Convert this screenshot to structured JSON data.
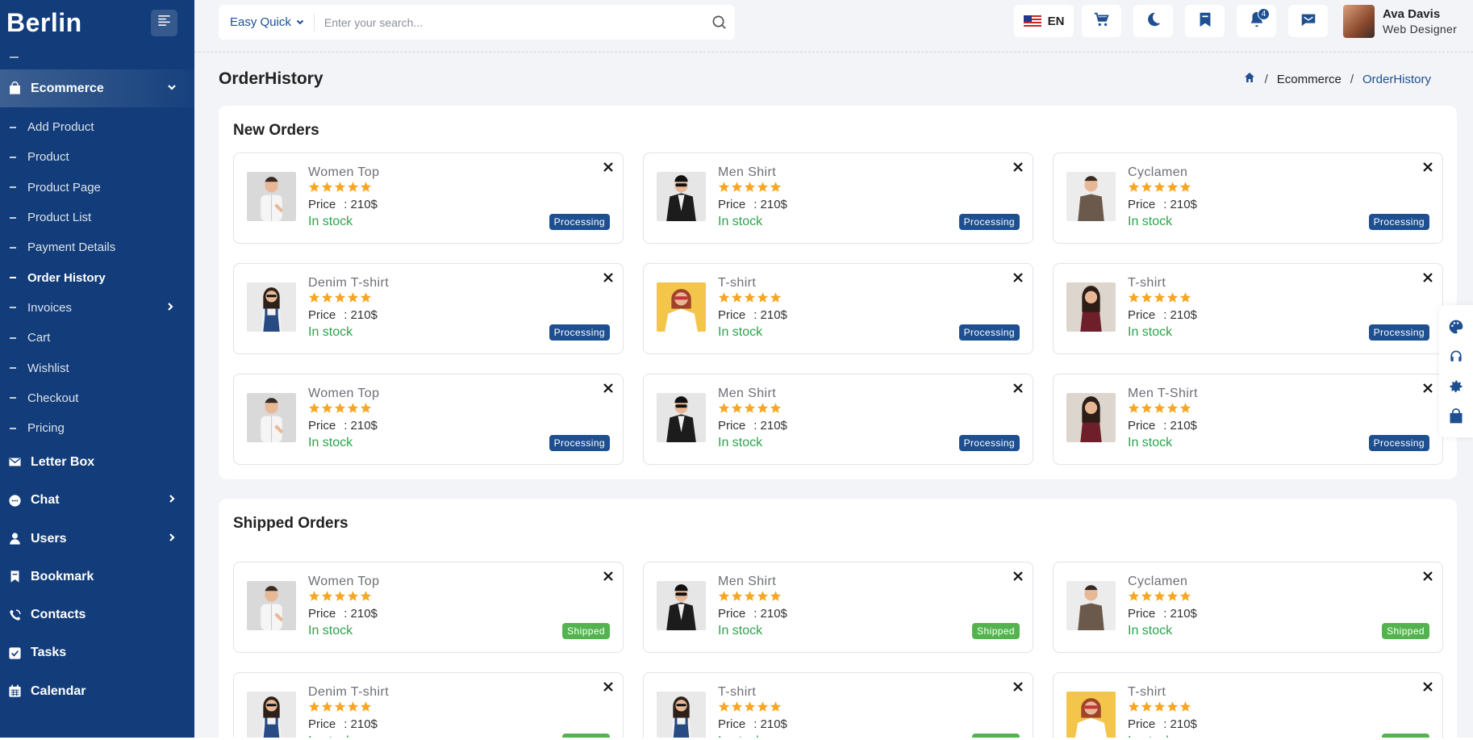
{
  "app": {
    "logo": "Berlin"
  },
  "sidebar": {
    "sections": [
      {
        "label": "Ecommerce",
        "icon": "shopping-bag-icon",
        "expanded": true,
        "active": true
      }
    ],
    "ecommerce_items": [
      {
        "label": "Add Product",
        "has_submenu": false,
        "current": false
      },
      {
        "label": "Product",
        "has_submenu": false,
        "current": false
      },
      {
        "label": "Product Page",
        "has_submenu": false,
        "current": false
      },
      {
        "label": "Product List",
        "has_submenu": false,
        "current": false
      },
      {
        "label": "Payment Details",
        "has_submenu": false,
        "current": false
      },
      {
        "label": "Order History",
        "has_submenu": false,
        "current": true
      },
      {
        "label": "Invoices",
        "has_submenu": true,
        "current": false
      },
      {
        "label": "Cart",
        "has_submenu": false,
        "current": false
      },
      {
        "label": "Wishlist",
        "has_submenu": false,
        "current": false
      },
      {
        "label": "Checkout",
        "has_submenu": false,
        "current": false
      },
      {
        "label": "Pricing",
        "has_submenu": false,
        "current": false
      }
    ],
    "main_items": [
      {
        "label": "Letter Box",
        "icon": "mail-icon",
        "has_submenu": false
      },
      {
        "label": "Chat",
        "icon": "chat-icon",
        "has_submenu": true
      },
      {
        "label": "Users",
        "icon": "user-icon",
        "has_submenu": true
      },
      {
        "label": "Bookmark",
        "icon": "bookmark-icon",
        "has_submenu": false
      },
      {
        "label": "Contacts",
        "icon": "phone-icon",
        "has_submenu": false
      },
      {
        "label": "Tasks",
        "icon": "checkbox-icon",
        "has_submenu": false
      },
      {
        "label": "Calendar",
        "icon": "calendar-icon",
        "has_submenu": false
      }
    ]
  },
  "header": {
    "quick_label": "Easy Quick",
    "search_placeholder": "Enter your search...",
    "language": "EN",
    "notification_count": "4",
    "user": {
      "name": "Ava Davis",
      "role": "Web Designer"
    }
  },
  "page": {
    "title": "OrderHistory",
    "breadcrumb": [
      "Ecommerce",
      "OrderHistory"
    ]
  },
  "new_orders": {
    "title": "New Orders",
    "items": [
      {
        "name": "Women Top",
        "price_label": "Price",
        "price": ": 210$",
        "stock": "In stock",
        "status": "Processing",
        "image": "man-white-shirt"
      },
      {
        "name": "Men Shirt",
        "price_label": "Price",
        "price": ": 210$",
        "stock": "In stock",
        "status": "Processing",
        "image": "man-black-jacket"
      },
      {
        "name": "Cyclamen",
        "price_label": "Price",
        "price": ": 210$",
        "stock": "In stock",
        "status": "Processing",
        "image": "man-brown-sweater"
      },
      {
        "name": "Denim T-shirt",
        "price_label": "Price",
        "price": ": 210$",
        "stock": "In stock",
        "status": "Processing",
        "image": "woman-denim-overalls"
      },
      {
        "name": "T-shirt",
        "price_label": "Price",
        "price": ": 210$",
        "stock": "In stock",
        "status": "Processing",
        "image": "woman-yellow-background"
      },
      {
        "name": "T-shirt",
        "price_label": "Price",
        "price": ": 210$",
        "stock": "In stock",
        "status": "Processing",
        "image": "woman-maroon-top"
      },
      {
        "name": "Women Top",
        "price_label": "Price",
        "price": ": 210$",
        "stock": "In stock",
        "status": "Processing",
        "image": "man-white-shirt"
      },
      {
        "name": "Men Shirt",
        "price_label": "Price",
        "price": ": 210$",
        "stock": "In stock",
        "status": "Processing",
        "image": "man-black-jacket"
      },
      {
        "name": "Men T-Shirt",
        "price_label": "Price",
        "price": ": 210$",
        "stock": "In stock",
        "status": "Processing",
        "image": "woman-maroon-top"
      }
    ]
  },
  "shipped_orders": {
    "title": "Shipped Orders",
    "items": [
      {
        "name": "Women Top",
        "price_label": "Price",
        "price": ": 210$",
        "stock": "In stock",
        "status": "Shipped",
        "image": "man-white-shirt"
      },
      {
        "name": "Men Shirt",
        "price_label": "Price",
        "price": ": 210$",
        "stock": "In stock",
        "status": "Shipped",
        "image": "man-black-jacket"
      },
      {
        "name": "Cyclamen",
        "price_label": "Price",
        "price": ": 210$",
        "stock": "In stock",
        "status": "Shipped",
        "image": "man-brown-sweater"
      },
      {
        "name": "Denim T-shirt",
        "price_label": "Price",
        "price": ": 210$",
        "stock": "In stock",
        "status": "Shipped",
        "image": "woman-denim-overalls"
      },
      {
        "name": "T-shirt",
        "price_label": "Price",
        "price": ": 210$",
        "stock": "In stock",
        "status": "Shipped",
        "image": "woman-denim-overalls"
      },
      {
        "name": "T-shirt",
        "price_label": "Price",
        "price": ": 210$",
        "stock": "In stock",
        "status": "Shipped",
        "image": "woman-yellow-background"
      }
    ]
  },
  "float_tools": [
    "palette-icon",
    "headset-icon",
    "settings-icon",
    "shopping-bag-icon"
  ],
  "colors": {
    "sidebar": "#123d7a",
    "accent": "#1d4f91",
    "processing": "#1d4f91",
    "shipped": "#53b44f",
    "stock": "#2aa44b",
    "star": "#f6a623"
  }
}
